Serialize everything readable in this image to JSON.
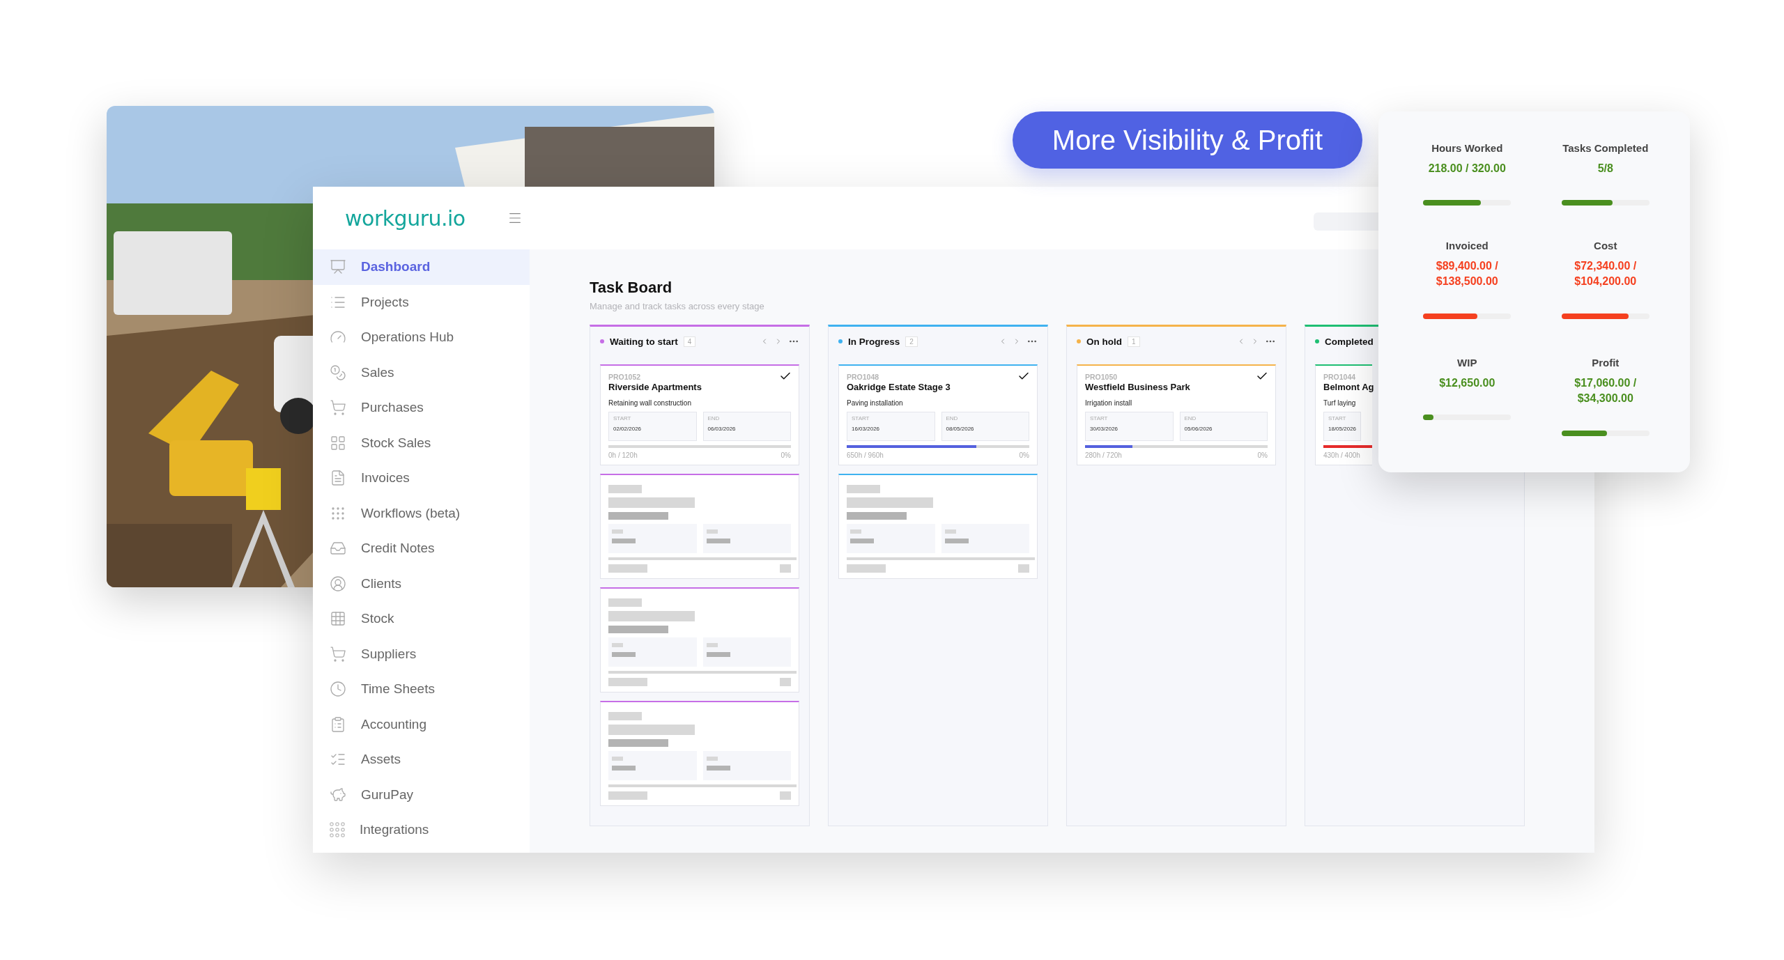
{
  "banner": {
    "text": "More Visibility & Profit"
  },
  "app": {
    "logo": "workguru.io",
    "sidebar": {
      "items": [
        {
          "label": "Dashboard",
          "selected": true
        },
        {
          "label": "Projects",
          "selected": false
        },
        {
          "label": "Operations Hub",
          "selected": false
        },
        {
          "label": "Sales",
          "selected": false
        },
        {
          "label": "Purchases",
          "selected": false
        },
        {
          "label": "Stock Sales",
          "selected": false
        },
        {
          "label": "Invoices",
          "selected": false
        },
        {
          "label": "Workflows (beta)",
          "selected": false
        },
        {
          "label": "Credit Notes",
          "selected": false
        },
        {
          "label": "Clients",
          "selected": false
        },
        {
          "label": "Stock",
          "selected": false
        },
        {
          "label": "Suppliers",
          "selected": false
        },
        {
          "label": "Time Sheets",
          "selected": false
        },
        {
          "label": "Accounting",
          "selected": false
        },
        {
          "label": "Assets",
          "selected": false
        },
        {
          "label": "GuruPay",
          "selected": false
        },
        {
          "label": "Integrations",
          "selected": false
        }
      ]
    },
    "page": {
      "title": "Task Board",
      "subtitle": "Manage and track tasks across every stage"
    },
    "columns": [
      {
        "name": "Waiting to start",
        "count": "4",
        "color": "#c66ee6",
        "controls": true,
        "cards": [
          {
            "kind": "task",
            "code": "PRO1052",
            "title": "Riverside Apartments",
            "task": "Retaining wall construction",
            "checked": true,
            "start_label": "START",
            "start": "02/02/2026",
            "end_label": "END",
            "end": "06/03/2026",
            "level": 0,
            "hours": "0h / 120h",
            "percent": "0%"
          },
          {
            "kind": "skeleton"
          },
          {
            "kind": "skeleton"
          },
          {
            "kind": "skeleton"
          }
        ]
      },
      {
        "name": "In Progress",
        "count": "2",
        "color": "#3fb2f0",
        "controls": true,
        "cards": [
          {
            "kind": "task",
            "code": "PRO1048",
            "title": "Oakridge Estate Stage 3",
            "task": "Paving installation",
            "checked": true,
            "start_label": "START",
            "start": "16/03/2026",
            "end_label": "END",
            "end": "08/05/2026",
            "level": 0.71,
            "over_budget": false,
            "hours": "650h / 960h",
            "percent": "0%"
          },
          {
            "kind": "skeleton"
          }
        ]
      },
      {
        "name": "On hold",
        "count": "1",
        "color": "#f5b34a",
        "controls": true,
        "cards": [
          {
            "kind": "task",
            "code": "PRO1050",
            "title": "Westfield Business Park",
            "task": "Irrigation install",
            "checked": true,
            "start_label": "START",
            "start": "30/03/2026",
            "end_label": "END",
            "end": "05/06/2026",
            "level": 0.26,
            "over_budget": false,
            "hours": "280h / 720h",
            "percent": "0%"
          }
        ]
      },
      {
        "name": "Completed",
        "color": "#1fbf73",
        "controls": false,
        "cards": [
          {
            "kind": "task",
            "code": "PRO1044",
            "title": "Belmont Ag",
            "task": "Turf laying",
            "checked": false,
            "start_label": "START",
            "start": "18/05/2026",
            "level": 1,
            "over_budget": true,
            "hours": "430h / 400h"
          }
        ]
      }
    ]
  },
  "stats": [
    {
      "label": "Hours Worked",
      "value": "218.00 / 320.00",
      "color": "#4a8f1f",
      "level": 0.66
    },
    {
      "label": "Tasks Completed",
      "value": "5/8",
      "color": "#4a8f1f",
      "level": 0.58
    },
    {
      "label": "Invoiced",
      "value": "$89,400.00 / $138,500.00",
      "color": "#f5401f",
      "level": 0.62
    },
    {
      "label": "Cost",
      "value": "$72,340.00 / $104,200.00",
      "color": "#f5401f",
      "level": 0.76
    },
    {
      "label": "WIP",
      "value": "$12,650.00",
      "color": "#4a8f1f",
      "level": 0.12
    },
    {
      "label": "Profit",
      "value": "$17,060.00 / $34,300.00",
      "color": "#4a8f1f",
      "level": 0.52
    }
  ]
}
